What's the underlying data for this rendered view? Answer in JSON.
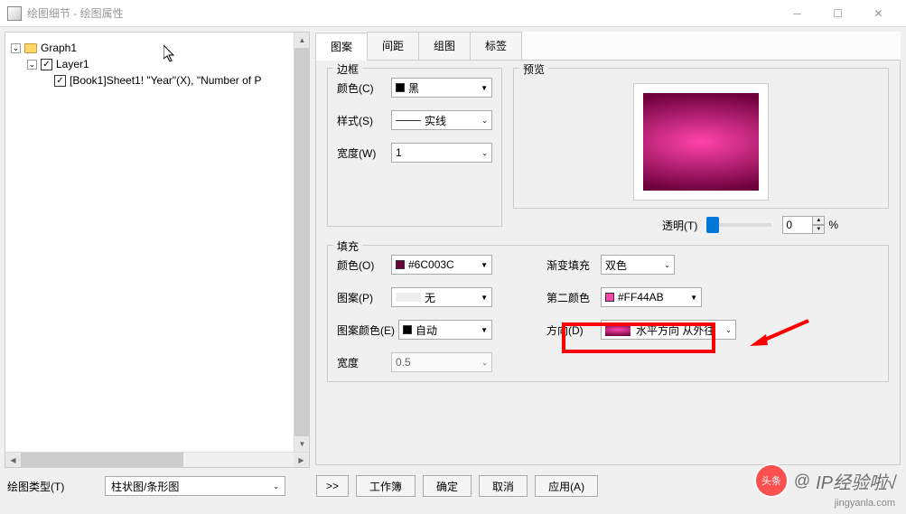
{
  "window": {
    "title": "绘图细节 - 绘图属性"
  },
  "tree": {
    "nodes": [
      {
        "label": "Graph1",
        "level": 0,
        "expander": "⌄",
        "icon": "folder",
        "checkbox": null
      },
      {
        "label": "Layer1",
        "level": 1,
        "expander": "⌄",
        "icon": null,
        "checkbox": "✓"
      },
      {
        "label": "[Book1]Sheet1! \"Year\"(X), \"Number of P",
        "level": 2,
        "expander": null,
        "icon": null,
        "checkbox": "✓"
      }
    ]
  },
  "tabs": {
    "items": [
      "图案",
      "间距",
      "组图",
      "标签"
    ],
    "active": 0
  },
  "border": {
    "legend": "边框",
    "color_label": "颜色(C)",
    "color_value": "黑",
    "style_label": "样式(S)",
    "style_value": "实线",
    "width_label": "宽度(W)",
    "width_value": "1"
  },
  "preview": {
    "legend": "预览"
  },
  "transparency": {
    "label": "透明(T)",
    "value": "0",
    "suffix": "%"
  },
  "fill": {
    "legend": "填充",
    "color_label": "颜色(O)",
    "color_value": "#6C003C",
    "pattern_label": "图案(P)",
    "pattern_value": "无",
    "pattern_color_label": "图案颜色(E)",
    "pattern_color_value": "自动",
    "width_label": "宽度",
    "width_value": "0.5",
    "gradient_label": "渐变填充",
    "gradient_value": "双色",
    "second_color_label": "第二颜色",
    "second_color_value": "#FF44AB",
    "direction_label": "方向(D)",
    "direction_value": "水平方向 从外往"
  },
  "bottom": {
    "type_label": "绘图类型(T)",
    "type_value": "柱状图/条形图",
    "more_btn": ">>",
    "workbook_btn": "工作簿",
    "ok_btn": "确定",
    "cancel_btn": "取消",
    "apply_btn": "应用(A)"
  },
  "watermark": {
    "circle": "头条",
    "at": "@",
    "text": "IP经验啦√",
    "sub": "jingyanla.com"
  }
}
